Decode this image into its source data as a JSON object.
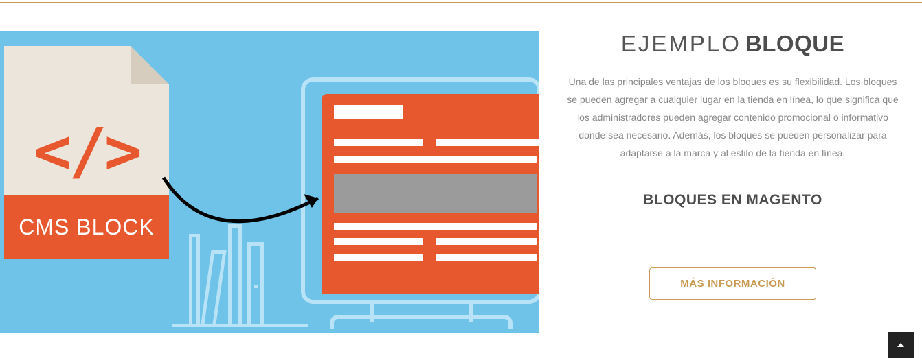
{
  "colors": {
    "accent": "#c89a52",
    "orange": "#e8582f",
    "sky": "#6fc3e8"
  },
  "illustration": {
    "code_glyph": "</>",
    "cms_label": "CMS BLOCK"
  },
  "heading": {
    "light": "EJEMPLO",
    "bold": "BLOQUE"
  },
  "description": "Una de las principales ventajas de los bloques es su flexibilidad. Los bloques se pueden agregar a cualquier lugar en la tienda en línea, lo que significa que los administradores pueden agregar contenido promocional o informativo donde sea necesario. Además, los bloques se pueden personalizar para adaptarse a la marca y al estilo de la tienda en línea.",
  "subheading": "BLOQUES EN MAGENTO",
  "cta_label": "MÁS INFORMACIÓN"
}
